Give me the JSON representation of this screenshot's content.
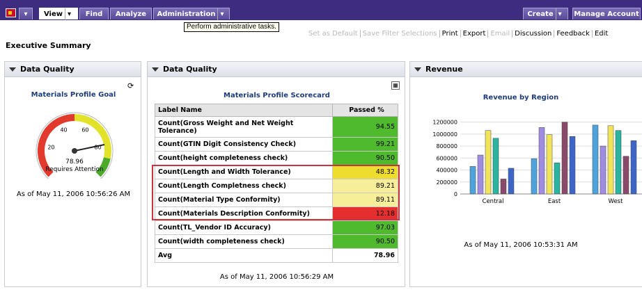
{
  "nav": {
    "tabs": [
      {
        "label": "View"
      },
      {
        "label": "Find"
      },
      {
        "label": "Analyze"
      },
      {
        "label": "Administration"
      }
    ],
    "right_tabs": [
      {
        "label": "Create"
      },
      {
        "label": "Manage Account"
      }
    ],
    "tooltip": "Perform administrative tasks."
  },
  "toolbar": {
    "items": [
      {
        "label": "Set as Default",
        "enabled": false
      },
      {
        "label": "Save Filter Selections",
        "enabled": false
      },
      {
        "label": "Print",
        "enabled": true
      },
      {
        "label": "Export",
        "enabled": true
      },
      {
        "label": "Email",
        "enabled": false
      },
      {
        "label": "Discussion",
        "enabled": true
      },
      {
        "label": "Feedback",
        "enabled": true
      },
      {
        "label": "Edit",
        "enabled": true
      }
    ]
  },
  "page_title": "Executive Summary",
  "panels": {
    "dq1": {
      "title": "Data Quality",
      "chart_title": "Materials Profile Goal",
      "gauge": {
        "value": 78.96,
        "min": 0,
        "max": 100,
        "ticks": [
          "20",
          "40",
          "60",
          "80"
        ],
        "status": "Requires Attention",
        "zones": [
          {
            "from": 0,
            "to": 50,
            "color": "#e23a2c"
          },
          {
            "from": 50,
            "to": 88,
            "color": "#e2e22a"
          },
          {
            "from": 88,
            "to": 100,
            "color": "#4caa2a"
          }
        ]
      },
      "timestamp": "As of May 11, 2006 10:56:26 AM"
    },
    "dq2": {
      "title": "Data Quality",
      "chart_title": "Materials Profile Scorecard",
      "columns": [
        "Label Name",
        "Passed %"
      ],
      "rows": [
        {
          "label": "Count(Gross Weight and Net Weight Tolerance)",
          "value": "94.55",
          "color": "#4fba2e"
        },
        {
          "label": "Count(GTIN Digit Consistency Check)",
          "value": "99.21",
          "color": "#4fba2e"
        },
        {
          "label": "Count(height completeness check)",
          "value": "90.50",
          "color": "#4fba2e"
        },
        {
          "label": "Count(Length and Width Tolerance)",
          "value": "48.32",
          "color": "#eedc2e"
        },
        {
          "label": "Count(Length Completness check)",
          "value": "89.21",
          "color": "#f6ee98"
        },
        {
          "label": "Count(Material Type Conformity)",
          "value": "89.11",
          "color": "#f6ee98"
        },
        {
          "label": "Count(Materials Description Conformity)",
          "value": "12.18",
          "color": "#e52e2e"
        },
        {
          "label": "Count(TL_Vendor ID Accuracy)",
          "value": "97.03",
          "color": "#4fba2e"
        },
        {
          "label": "Count(width completeness check)",
          "value": "90.50",
          "color": "#4fba2e"
        },
        {
          "label": "Avg",
          "value": "78.96",
          "color": "#ffffff"
        }
      ],
      "timestamp": "As of May 11, 2006 10:56:29 AM"
    },
    "revenue": {
      "title": "Revenue",
      "timestamp": "As of May 11, 2006 10:53:31 AM"
    }
  },
  "chart_data": {
    "type": "bar",
    "title": "Revenue by Region",
    "categories": [
      "Central",
      "East",
      "West"
    ],
    "yticks": [
      "0",
      "200000",
      "400000",
      "600000",
      "800000",
      "1000000",
      "1200000"
    ],
    "ylim": [
      0,
      1300000
    ],
    "colors": [
      "#4ea3dd",
      "#a08ce0",
      "#f1e45a",
      "#2bb4a0",
      "#8b4a6a",
      "#3e66c6",
      "#b94c4c",
      "#7fd37f"
    ],
    "series_values": [
      [
        460000,
        590000,
        1150000
      ],
      [
        650000,
        1110000,
        800000
      ],
      [
        1060000,
        990000,
        1140000
      ],
      [
        930000,
        520000,
        1060000
      ],
      [
        250000,
        1200000,
        630000
      ],
      [
        430000,
        960000,
        890000
      ]
    ]
  }
}
